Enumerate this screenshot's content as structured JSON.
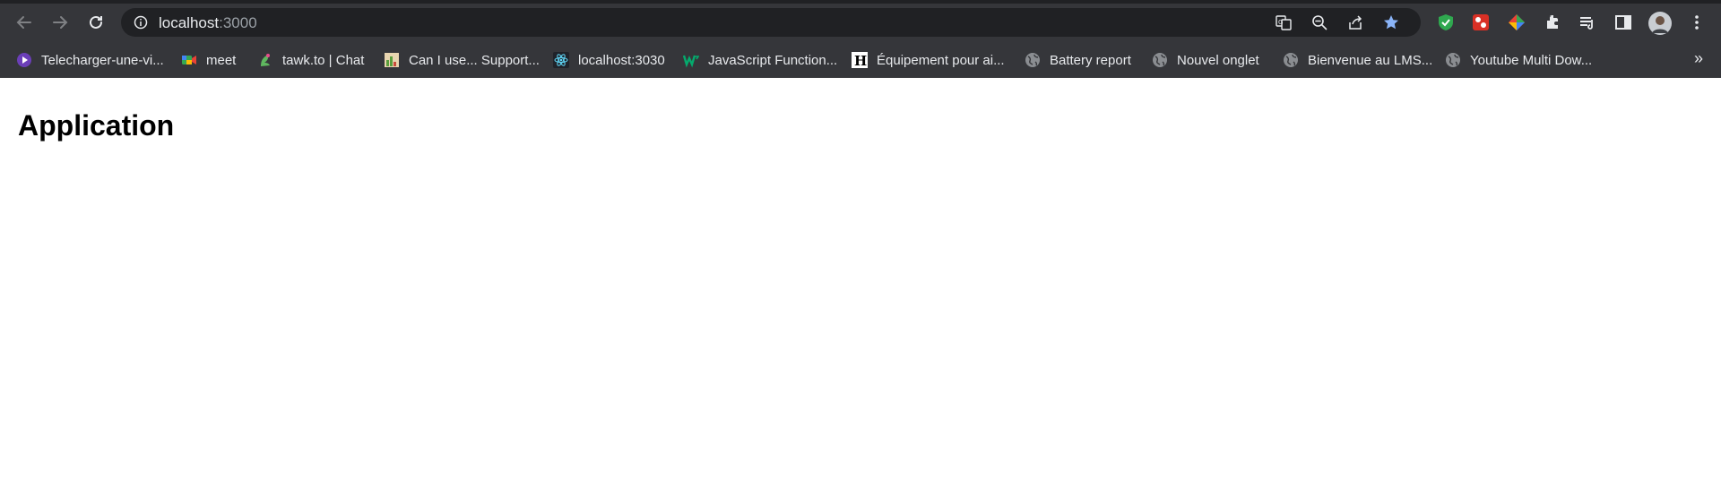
{
  "browser": {
    "url_host": "localhost",
    "url_port": ":3000",
    "colors": {
      "chrome": "#35363a",
      "omnibox": "#202124",
      "text": "#e8eaed",
      "muted": "#9aa0a6",
      "star": "#8ab4f8"
    }
  },
  "bookmarks": [
    {
      "label": "Telecharger-une-vi...",
      "icon": "video-play-icon"
    },
    {
      "label": "meet",
      "icon": "google-meet-icon"
    },
    {
      "label": "tawk.to | Chat",
      "icon": "tawk-icon"
    },
    {
      "label": "Can I use... Support...",
      "icon": "caniuse-icon"
    },
    {
      "label": "localhost:3030",
      "icon": "react-icon"
    },
    {
      "label": "JavaScript Function...",
      "icon": "w3-icon"
    },
    {
      "label": "Équipement pour ai...",
      "icon": "h-letter-icon"
    },
    {
      "label": "Battery report",
      "icon": "globe-icon"
    },
    {
      "label": "Nouvel onglet",
      "icon": "globe-icon"
    },
    {
      "label": "Bienvenue au LMS...",
      "icon": "globe-icon"
    },
    {
      "label": "Youtube Multi Dow...",
      "icon": "globe-icon"
    }
  ],
  "bookmarks_more": "»",
  "page": {
    "heading": "Application"
  }
}
